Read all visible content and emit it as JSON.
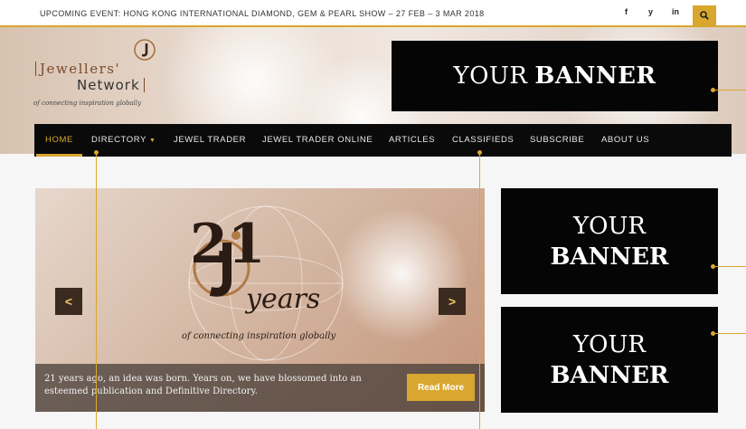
{
  "topbar": {
    "event_text": "UPCOMING EVENT: HONG KONG INTERNATIONAL DIAMOND, GEM & PEARL SHOW – 27 FEB – 3 MAR 2018",
    "social": [
      "f",
      "y",
      "in"
    ],
    "search_icon": "search-icon"
  },
  "logo": {
    "line1": "Jewellers'",
    "line2": "Network",
    "tagline": "of connecting inspiration globally"
  },
  "banners": {
    "top": {
      "line1": "YOUR",
      "line2": "BANNER"
    },
    "side1": {
      "line1": "YOUR",
      "line2": "BANNER"
    },
    "side2": {
      "line1": "YOUR",
      "line2": "BANNER"
    }
  },
  "nav": {
    "items": [
      {
        "label": "HOME",
        "active": true
      },
      {
        "label": "DIRECTORY",
        "has_dropdown": true
      },
      {
        "label": "JEWEL TRADER"
      },
      {
        "label": "JEWEL TRADER ONLINE"
      },
      {
        "label": "ARTICLES"
      },
      {
        "label": "CLASSIFIEDS"
      },
      {
        "label": "SUBSCRIBE"
      },
      {
        "label": "ABOUT US"
      }
    ]
  },
  "slider": {
    "emblem_number": "21",
    "emblem_word": "years",
    "emblem_tagline": "of connecting inspiration globally",
    "prev_label": "<",
    "next_label": ">",
    "caption": "21 years ago, an idea was born. Years on, we have blossomed into an esteemed publication and Definitive Directory.",
    "button_label": "Read More"
  },
  "colors": {
    "accent": "#d9a72f",
    "nav_bg": "#0a0a0a",
    "banner_bg": "#050505"
  }
}
